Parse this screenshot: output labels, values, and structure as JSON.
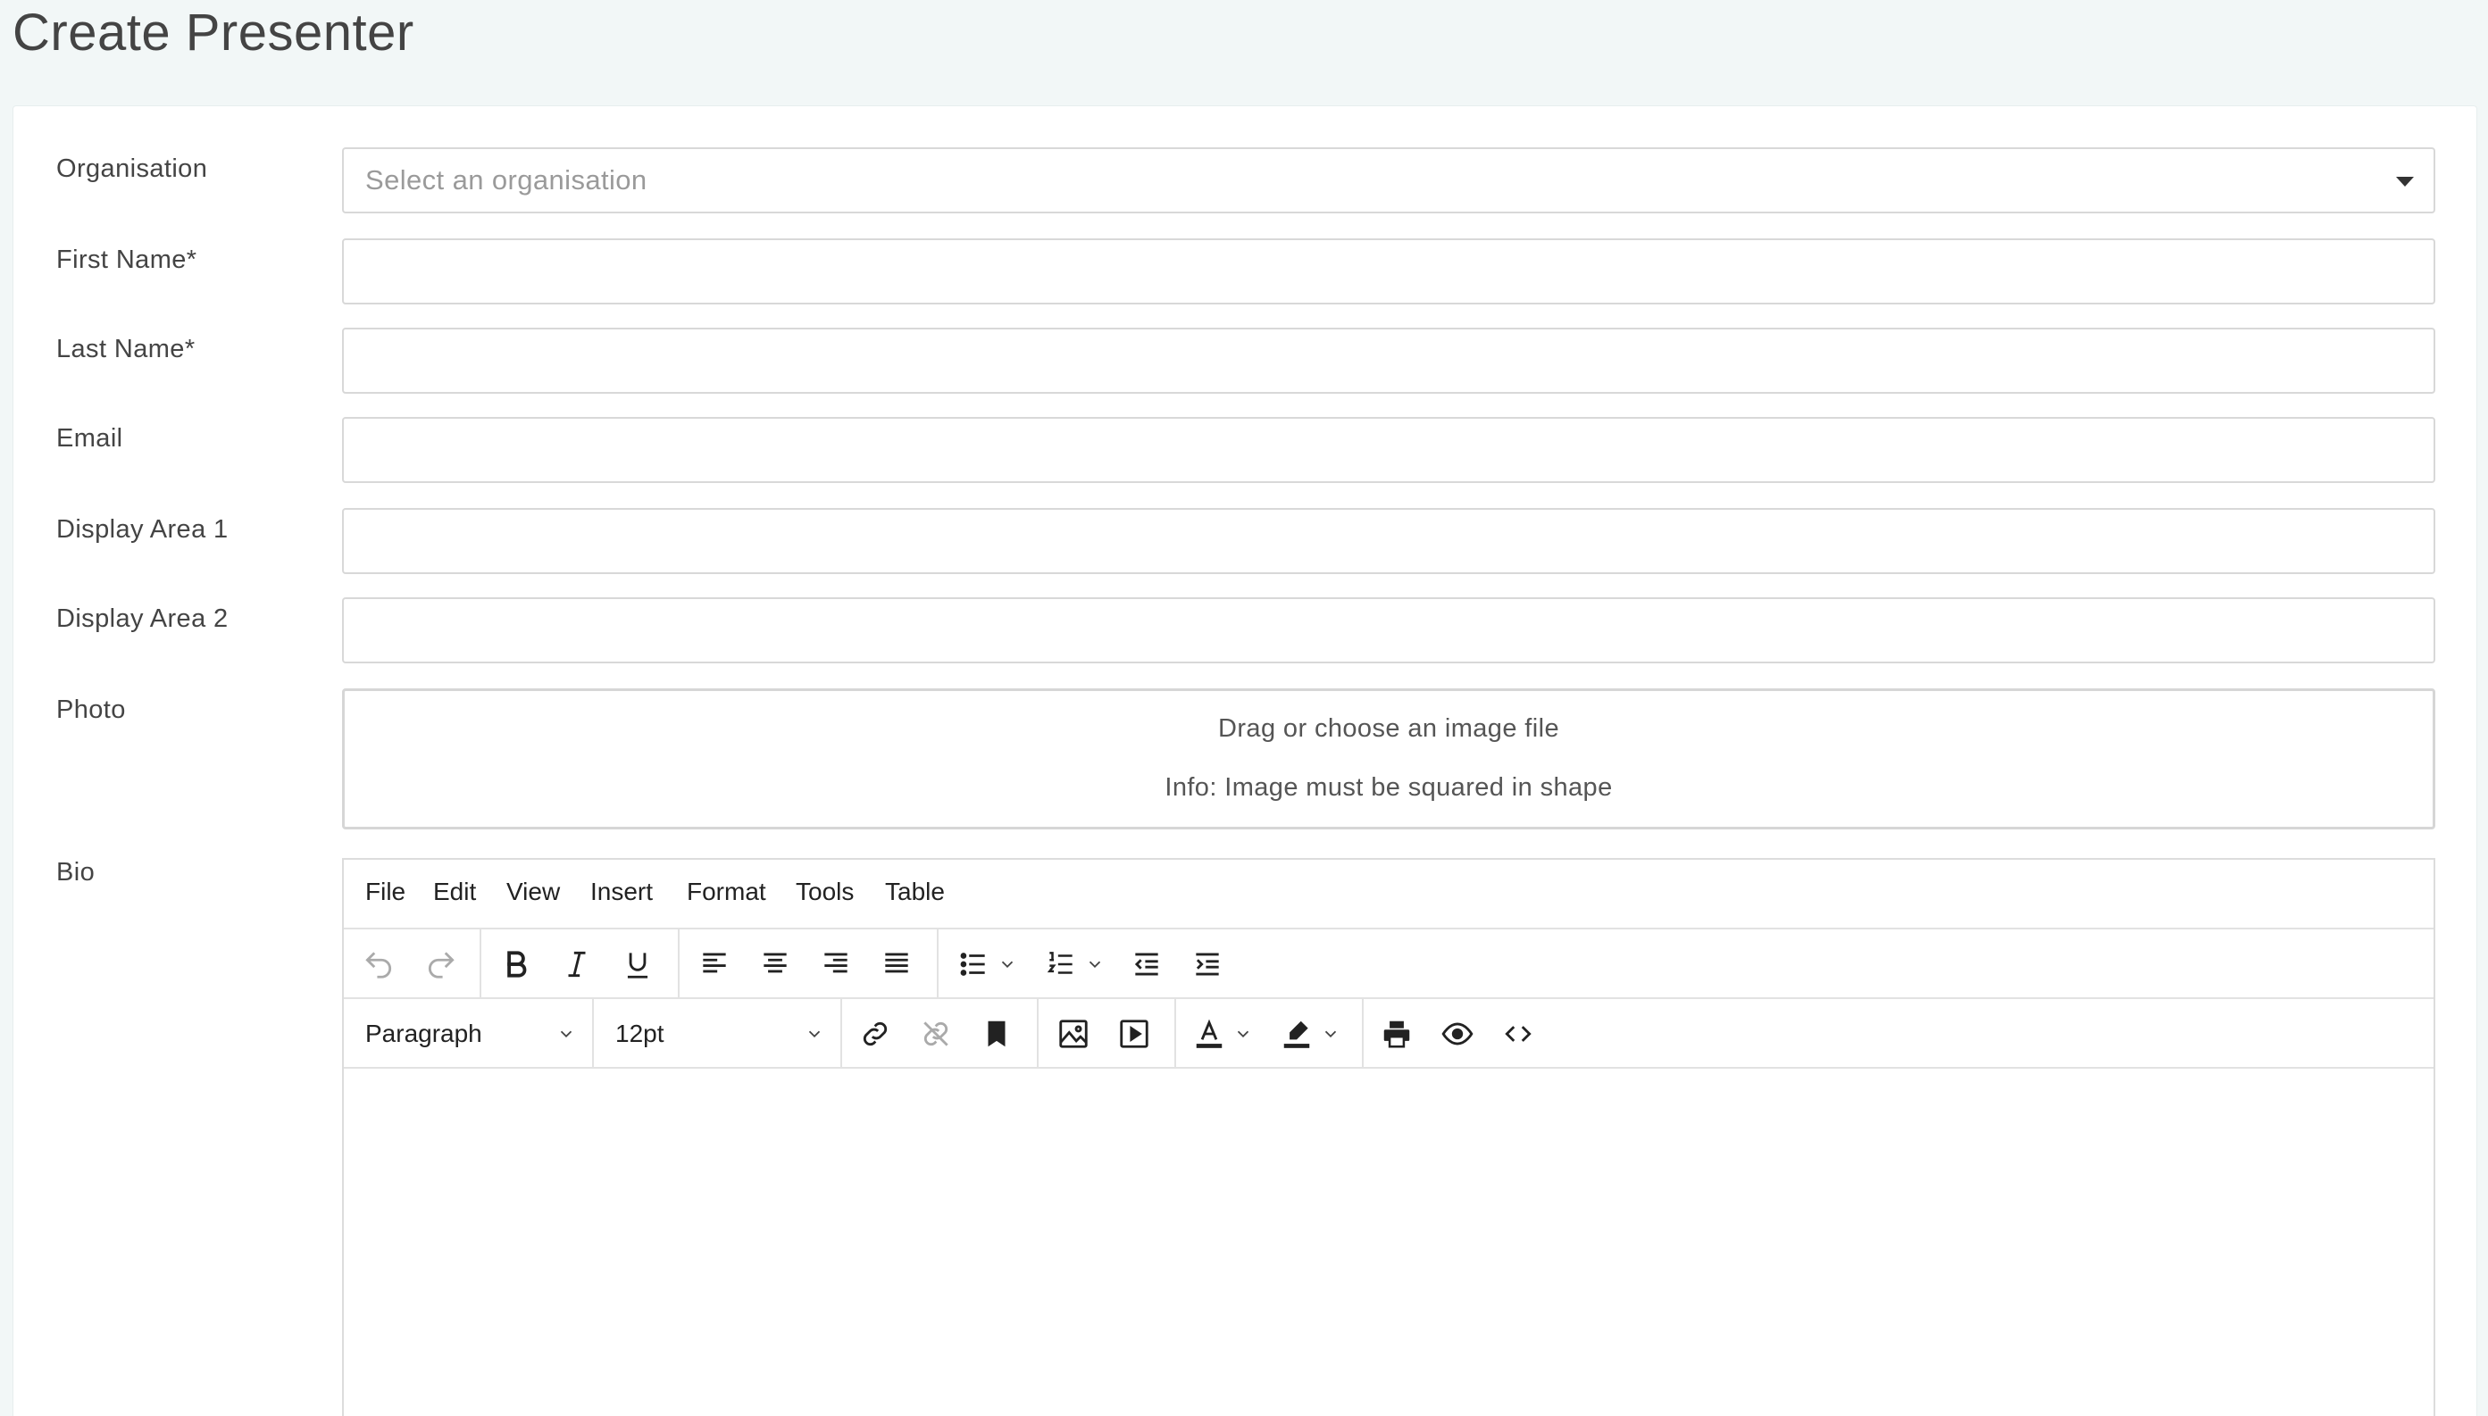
{
  "page": {
    "title": "Create Presenter"
  },
  "form": {
    "organisation": {
      "label": "Organisation",
      "placeholder": "Select an organisation"
    },
    "first_name": {
      "label": "First Name*",
      "value": ""
    },
    "last_name": {
      "label": "Last Name*",
      "value": ""
    },
    "email": {
      "label": "Email",
      "value": ""
    },
    "display_area_1": {
      "label": "Display Area 1",
      "value": ""
    },
    "display_area_2": {
      "label": "Display Area 2",
      "value": ""
    },
    "photo": {
      "label": "Photo",
      "prompt": "Drag or choose an image file",
      "info": "Info: Image must be squared in shape"
    },
    "bio": {
      "label": "Bio"
    }
  },
  "editor": {
    "menu": [
      "File",
      "Edit",
      "View",
      "Insert",
      "Format",
      "Tools",
      "Table"
    ],
    "block_format": "Paragraph",
    "font_size": "12pt",
    "icons": {
      "undo": "undo-icon",
      "redo": "redo-icon",
      "bold": "bold-icon",
      "italic": "italic-icon",
      "underline": "underline-icon",
      "align_left": "align-left-icon",
      "align_center": "align-center-icon",
      "align_right": "align-right-icon",
      "justify": "justify-icon",
      "bullet_list": "bullet-list-icon",
      "numbered_list": "numbered-list-icon",
      "outdent": "outdent-icon",
      "indent": "indent-icon",
      "link": "link-icon",
      "unlink": "unlink-icon",
      "bookmark": "bookmark-icon",
      "image": "image-icon",
      "media": "media-icon",
      "text_color": "text-color-icon",
      "highlight": "highlight-icon",
      "print": "print-icon",
      "preview": "preview-eye-icon",
      "code": "code-icon"
    }
  }
}
